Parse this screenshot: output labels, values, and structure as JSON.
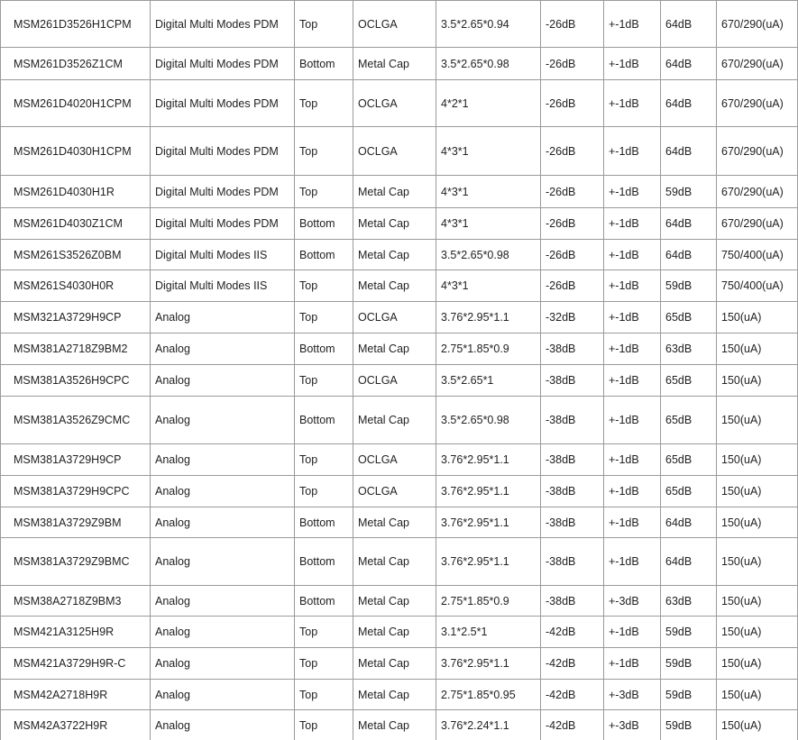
{
  "rows": [
    {
      "part": "MSM261D3526H1CPM",
      "type": "Digital Multi Modes PDM",
      "port": "Top",
      "package": "OCLGA",
      "size": "3.5*2.65*0.94",
      "sensitivity": "-26dB",
      "tolerance": "+-1dB",
      "snr": "64dB",
      "current": "670/290(uA)"
    },
    {
      "part": "MSM261D3526Z1CM",
      "type": "Digital Multi Modes PDM",
      "port": "Bottom",
      "package": "Metal Cap",
      "size": "3.5*2.65*0.98",
      "sensitivity": "-26dB",
      "tolerance": "+-1dB",
      "snr": "64dB",
      "current": "670/290(uA)"
    },
    {
      "part": "MSM261D4020H1CPM",
      "type": "Digital Multi Modes PDM",
      "port": "Top",
      "package": "OCLGA",
      "size": "4*2*1",
      "sensitivity": "-26dB",
      "tolerance": "+-1dB",
      "snr": "64dB",
      "current": "670/290(uA)"
    },
    {
      "part": "MSM261D4030H1CPM",
      "type": "Digital Multi Modes PDM",
      "port": "Top",
      "package": "OCLGA",
      "size": "4*3*1",
      "sensitivity": "-26dB",
      "tolerance": "+-1dB",
      "snr": "64dB",
      "current": "670/290(uA)"
    },
    {
      "part": "MSM261D4030H1R",
      "type": "Digital Multi Modes PDM",
      "port": "Top",
      "package": "Metal Cap",
      "size": "4*3*1",
      "sensitivity": "-26dB",
      "tolerance": "+-1dB",
      "snr": "59dB",
      "current": "670/290(uA)"
    },
    {
      "part": "MSM261D4030Z1CM",
      "type": "Digital Multi Modes PDM",
      "port": "Bottom",
      "package": "Metal Cap",
      "size": "4*3*1",
      "sensitivity": "-26dB",
      "tolerance": "+-1dB",
      "snr": "64dB",
      "current": "670/290(uA)"
    },
    {
      "part": "MSM261S3526Z0BM",
      "type": "Digital Multi Modes IIS",
      "port": "Bottom",
      "package": "Metal Cap",
      "size": "3.5*2.65*0.98",
      "sensitivity": "-26dB",
      "tolerance": "+-1dB",
      "snr": "64dB",
      "current": "750/400(uA)"
    },
    {
      "part": "MSM261S4030H0R",
      "type": "Digital Multi Modes IIS",
      "port": "Top",
      "package": "Metal Cap",
      "size": "4*3*1",
      "sensitivity": "-26dB",
      "tolerance": "+-1dB",
      "snr": "59dB",
      "current": "750/400(uA)"
    },
    {
      "part": "MSM321A3729H9CP",
      "type": "Analog",
      "port": "Top",
      "package": "OCLGA",
      "size": "3.76*2.95*1.1",
      "sensitivity": "-32dB",
      "tolerance": "+-1dB",
      "snr": "65dB",
      "current": "150(uA)"
    },
    {
      "part": "MSM381A2718Z9BM2",
      "type": "Analog",
      "port": "Bottom",
      "package": "Metal Cap",
      "size": "2.75*1.85*0.9",
      "sensitivity": "-38dB",
      "tolerance": "+-1dB",
      "snr": "63dB",
      "current": "150(uA)"
    },
    {
      "part": "MSM381A3526H9CPC",
      "type": "Analog",
      "port": "Top",
      "package": "OCLGA",
      "size": "3.5*2.65*1",
      "sensitivity": "-38dB",
      "tolerance": "+-1dB",
      "snr": "65dB",
      "current": "150(uA)"
    },
    {
      "part": "MSM381A3526Z9CMC",
      "type": "Analog",
      "port": "Bottom",
      "package": "Metal Cap",
      "size": "3.5*2.65*0.98",
      "sensitivity": "-38dB",
      "tolerance": "+-1dB",
      "snr": "65dB",
      "current": "150(uA)"
    },
    {
      "part": "MSM381A3729H9CP",
      "type": "Analog",
      "port": "Top",
      "package": "OCLGA",
      "size": "3.76*2.95*1.1",
      "sensitivity": "-38dB",
      "tolerance": "+-1dB",
      "snr": "65dB",
      "current": "150(uA)"
    },
    {
      "part": "MSM381A3729H9CPC",
      "type": "Analog",
      "port": "Top",
      "package": "OCLGA",
      "size": "3.76*2.95*1.1",
      "sensitivity": "-38dB",
      "tolerance": "+-1dB",
      "snr": "65dB",
      "current": "150(uA)"
    },
    {
      "part": "MSM381A3729Z9BM",
      "type": "Analog",
      "port": "Bottom",
      "package": "Metal Cap",
      "size": "3.76*2.95*1.1",
      "sensitivity": "-38dB",
      "tolerance": "+-1dB",
      "snr": "64dB",
      "current": "150(uA)"
    },
    {
      "part": "MSM381A3729Z9BMC",
      "type": "Analog",
      "port": "Bottom",
      "package": "Metal Cap",
      "size": "3.76*2.95*1.1",
      "sensitivity": "-38dB",
      "tolerance": "+-1dB",
      "snr": "64dB",
      "current": "150(uA)"
    },
    {
      "part": "MSM38A2718Z9BM3",
      "type": "Analog",
      "port": "Bottom",
      "package": "Metal Cap",
      "size": "2.75*1.85*0.9",
      "sensitivity": "-38dB",
      "tolerance": "+-3dB",
      "snr": "63dB",
      "current": "150(uA)"
    },
    {
      "part": "MSM421A3125H9R",
      "type": "Analog",
      "port": "Top",
      "package": "Metal Cap",
      "size": "3.1*2.5*1",
      "sensitivity": "-42dB",
      "tolerance": "+-1dB",
      "snr": "59dB",
      "current": "150(uA)"
    },
    {
      "part": "MSM421A3729H9R-C",
      "type": "Analog",
      "port": "Top",
      "package": "Metal Cap",
      "size": "3.76*2.95*1.1",
      "sensitivity": "-42dB",
      "tolerance": "+-1dB",
      "snr": "59dB",
      "current": "150(uA)"
    },
    {
      "part": "MSM42A2718H9R",
      "type": "Analog",
      "port": "Top",
      "package": "Metal Cap",
      "size": "2.75*1.85*0.95",
      "sensitivity": "-42dB",
      "tolerance": "+-3dB",
      "snr": "59dB",
      "current": "150(uA)"
    },
    {
      "part": "MSM42A3722H9R",
      "type": "Analog",
      "port": "Top",
      "package": "Metal Cap",
      "size": "3.76*2.24*1.1",
      "sensitivity": "-42dB",
      "tolerance": "+-3dB",
      "snr": "59dB",
      "current": "150(uA)"
    }
  ]
}
